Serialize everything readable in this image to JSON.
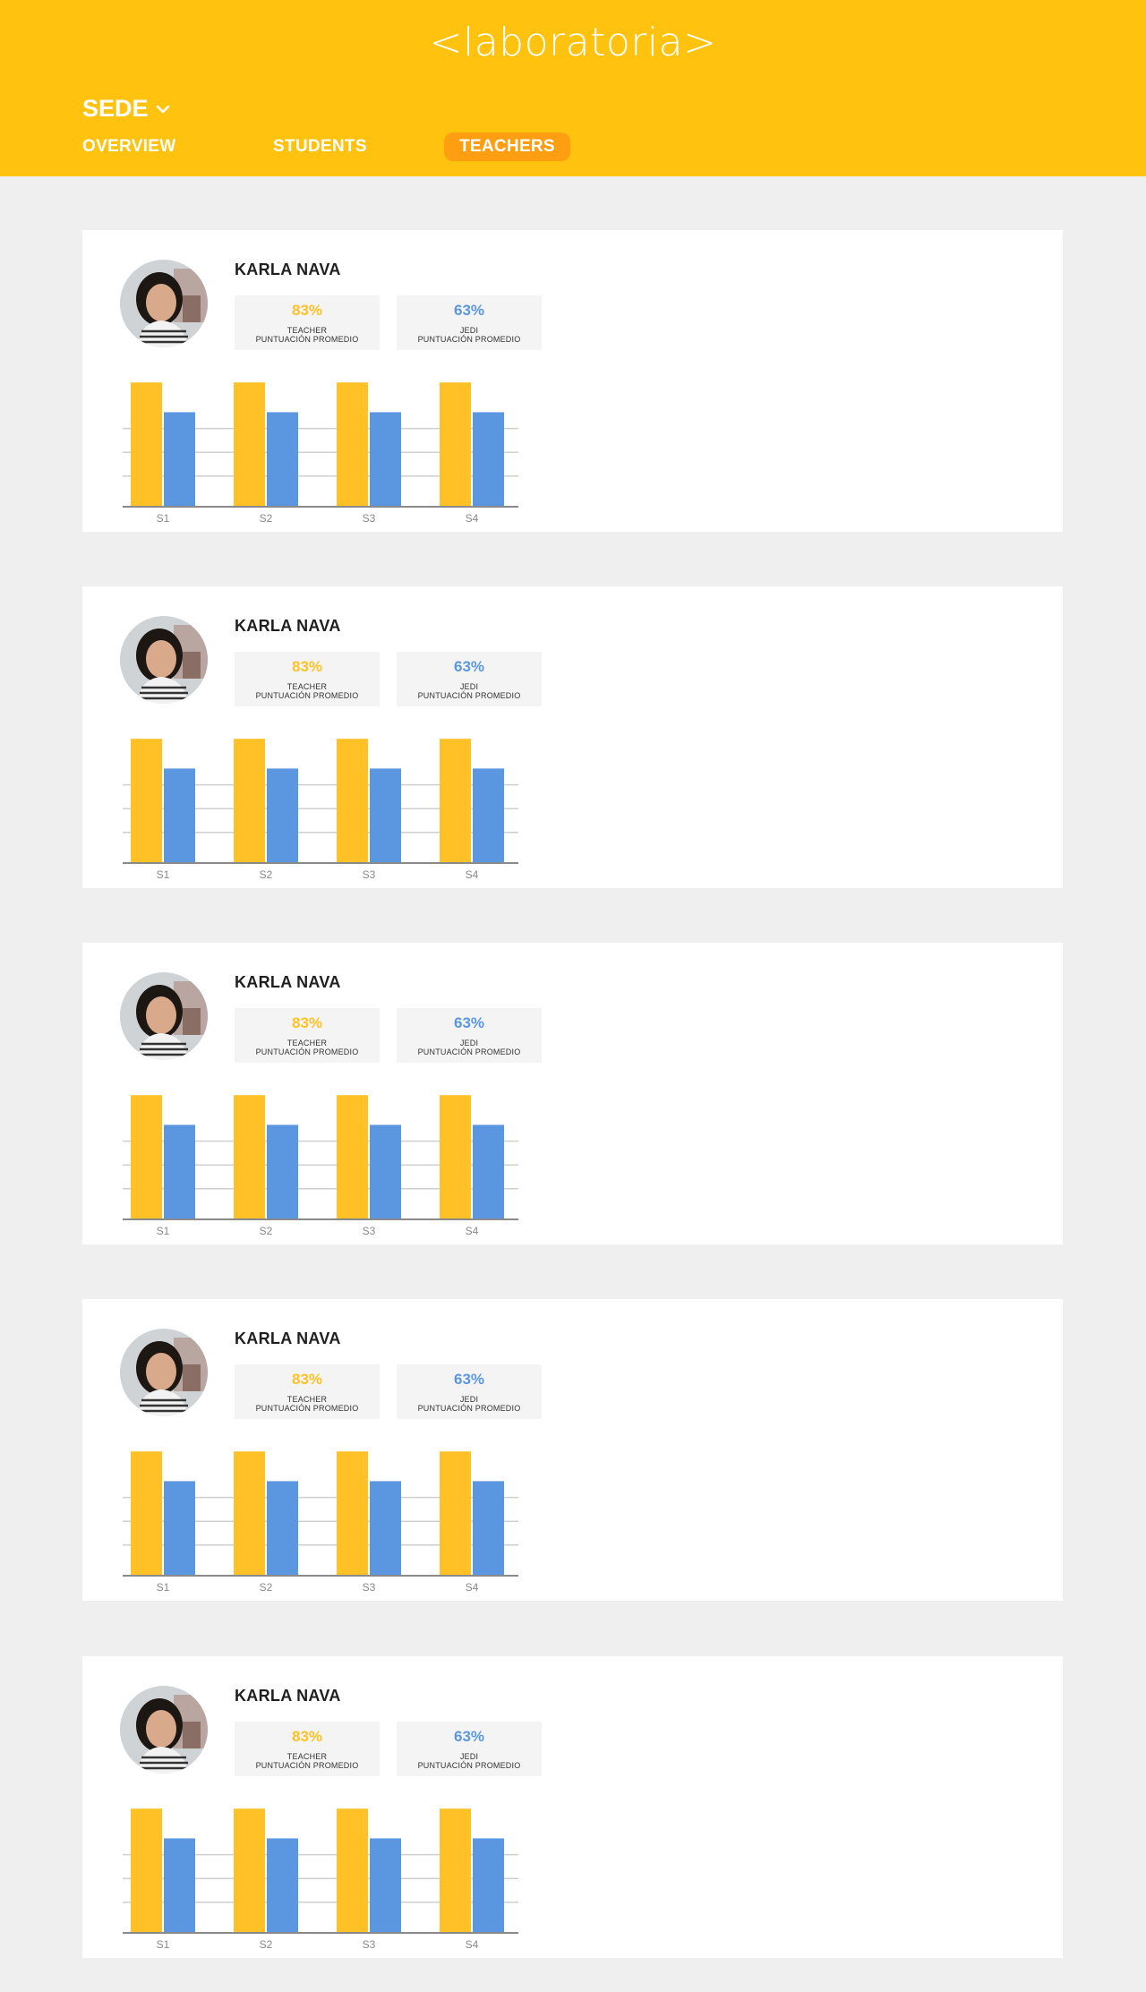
{
  "brand": {
    "logo_text": "<laboratoria>"
  },
  "colors": {
    "header": "#ffc20e",
    "active_tab": "#ff9e10",
    "teacher": "#ffc125",
    "jedi": "#5b97e0"
  },
  "nav": {
    "sede_label": "SEDE",
    "tabs": [
      {
        "label": "OVERVIEW",
        "active": false
      },
      {
        "label": "STUDENTS",
        "active": false
      },
      {
        "label": "TEACHERS",
        "active": true
      }
    ]
  },
  "teachers": [
    {
      "name": "KARLA NAVA",
      "teacher_pct": "83%",
      "teacher_label_1": "TEACHER",
      "teacher_label_2": "PUNTUACIÓN PROMEDIO",
      "jedi_pct": "63%",
      "jedi_label_1": "JEDI",
      "jedi_label_2": "PUNTUACIÓN PROMEDIO",
      "chart_data": {
        "type": "bar",
        "categories": [
          "S1",
          "S2",
          "S3",
          "S4"
        ],
        "ylim": [
          0,
          100
        ],
        "grid": true,
        "series": [
          {
            "color": "#ffc125",
            "values": [
              83,
              83,
              83,
              83
            ]
          },
          {
            "color": "#5b97e0",
            "values": [
              63,
              63,
              63,
              63
            ]
          }
        ]
      }
    },
    {
      "name": "KARLA NAVA",
      "teacher_pct": "83%",
      "teacher_label_1": "TEACHER",
      "teacher_label_2": "PUNTUACIÓN PROMEDIO",
      "jedi_pct": "63%",
      "jedi_label_1": "JEDI",
      "jedi_label_2": "PUNTUACIÓN PROMEDIO",
      "chart_data": {
        "type": "bar",
        "categories": [
          "S1",
          "S2",
          "S3",
          "S4"
        ],
        "ylim": [
          0,
          100
        ],
        "grid": true,
        "series": [
          {
            "color": "#ffc125",
            "values": [
              83,
              83,
              83,
              83
            ]
          },
          {
            "color": "#5b97e0",
            "values": [
              63,
              63,
              63,
              63
            ]
          }
        ]
      }
    },
    {
      "name": "KARLA NAVA",
      "teacher_pct": "83%",
      "teacher_label_1": "TEACHER",
      "teacher_label_2": "PUNTUACIÓN PROMEDIO",
      "jedi_pct": "63%",
      "jedi_label_1": "JEDI",
      "jedi_label_2": "PUNTUACIÓN PROMEDIO",
      "chart_data": {
        "type": "bar",
        "categories": [
          "S1",
          "S2",
          "S3",
          "S4"
        ],
        "ylim": [
          0,
          100
        ],
        "grid": true,
        "series": [
          {
            "color": "#ffc125",
            "values": [
              83,
              83,
              83,
              83
            ]
          },
          {
            "color": "#5b97e0",
            "values": [
              63,
              63,
              63,
              63
            ]
          }
        ]
      }
    },
    {
      "name": "KARLA NAVA",
      "teacher_pct": "83%",
      "teacher_label_1": "TEACHER",
      "teacher_label_2": "PUNTUACIÓN PROMEDIO",
      "jedi_pct": "63%",
      "jedi_label_1": "JEDI",
      "jedi_label_2": "PUNTUACIÓN PROMEDIO",
      "chart_data": {
        "type": "bar",
        "categories": [
          "S1",
          "S2",
          "S3",
          "S4"
        ],
        "ylim": [
          0,
          100
        ],
        "grid": true,
        "series": [
          {
            "color": "#ffc125",
            "values": [
              83,
              83,
              83,
              83
            ]
          },
          {
            "color": "#5b97e0",
            "values": [
              63,
              63,
              63,
              63
            ]
          }
        ]
      }
    },
    {
      "name": "KARLA NAVA",
      "teacher_pct": "83%",
      "teacher_label_1": "TEACHER",
      "teacher_label_2": "PUNTUACIÓN PROMEDIO",
      "jedi_pct": "63%",
      "jedi_label_1": "JEDI",
      "jedi_label_2": "PUNTUACIÓN PROMEDIO",
      "chart_data": {
        "type": "bar",
        "categories": [
          "S1",
          "S2",
          "S3",
          "S4"
        ],
        "ylim": [
          0,
          100
        ],
        "grid": true,
        "series": [
          {
            "color": "#ffc125",
            "values": [
              83,
              83,
              83,
              83
            ]
          },
          {
            "color": "#5b97e0",
            "values": [
              63,
              63,
              63,
              63
            ]
          }
        ]
      }
    }
  ]
}
